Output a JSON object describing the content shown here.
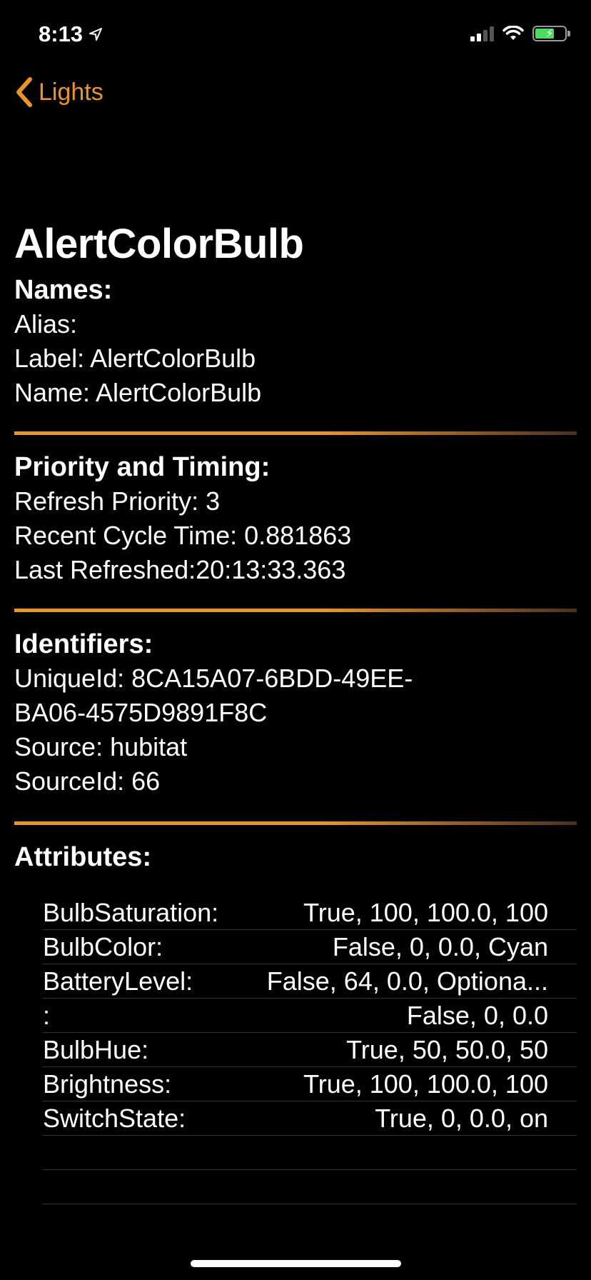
{
  "status_bar": {
    "time": "8:13"
  },
  "nav": {
    "back_label": "Lights"
  },
  "device": {
    "title": "AlertColorBulb"
  },
  "names": {
    "header": "Names:",
    "alias": "Alias:",
    "label": "Label: AlertColorBulb",
    "name": "Name: AlertColorBulb"
  },
  "priority": {
    "header": "Priority and Timing:",
    "refresh_priority": "Refresh Priority: 3",
    "recent_cycle_time": "Recent Cycle Time: 0.881863",
    "last_refreshed": "Last Refreshed:20:13:33.363"
  },
  "identifiers": {
    "header": "Identifiers:",
    "unique_id_line1": "UniqueId: 8CA15A07-6BDD-49EE-",
    "unique_id_line2": "BA06-4575D9891F8C",
    "source": "Source: hubitat",
    "source_id": "SourceId: 66"
  },
  "attributes": {
    "header": "Attributes:",
    "rows": [
      {
        "name": "BulbSaturation:",
        "value": "True,  100, 100.0, 100"
      },
      {
        "name": "BulbColor:",
        "value": "False,  0, 0.0, Cyan"
      },
      {
        "name": "BatteryLevel:",
        "value": "False,  64, 0.0, Optiona..."
      },
      {
        "name": ":",
        "value": "False,  0, 0.0"
      },
      {
        "name": "BulbHue:",
        "value": "True,  50, 50.0, 50"
      },
      {
        "name": "Brightness:",
        "value": "True,  100, 100.0, 100"
      },
      {
        "name": "SwitchState:",
        "value": "True,  0, 0.0, on"
      }
    ]
  },
  "colors": {
    "accent": "#e8952c",
    "background": "#000000",
    "text": "#ffffff"
  }
}
